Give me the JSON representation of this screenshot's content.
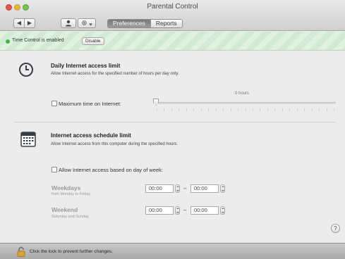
{
  "window": {
    "title": "Parental Control"
  },
  "toolbar": {
    "nav_back_glyph": "◀",
    "nav_forward_glyph": "▶",
    "user_icon": "user-icon",
    "gear_icon": "gear-icon",
    "tabs": [
      {
        "label": "Preferences",
        "selected": true
      },
      {
        "label": "Reports",
        "selected": false
      }
    ]
  },
  "status": {
    "text": "Time Control is enabled",
    "disable_label": "Disable",
    "color": "#4ab04a"
  },
  "daily": {
    "title": "Daily Internet access limit",
    "description": "Allow Internet access for the specified number of hours per day only.",
    "checkbox_label": "Maximum time on Internet:",
    "checked": false,
    "slider_value_text": "0 hours",
    "slider_value": 0
  },
  "schedule": {
    "title": "Internet access schedule limit",
    "description": "Allow Internet access from this computer during the specified hours.",
    "checkbox_label": "Allow Internet access based on day of week:",
    "checked": false,
    "rows": [
      {
        "title": "Weekdays",
        "subtitle": "from Monday to Friday",
        "from": "00:00",
        "to": "00:00",
        "separator": "–"
      },
      {
        "title": "Weekend",
        "subtitle": "Saturday and Sunday",
        "from": "00:00",
        "to": "00:00",
        "separator": "–"
      }
    ]
  },
  "help": {
    "label": "?"
  },
  "footer": {
    "lock_text": "Click the lock to prevent further changes."
  }
}
